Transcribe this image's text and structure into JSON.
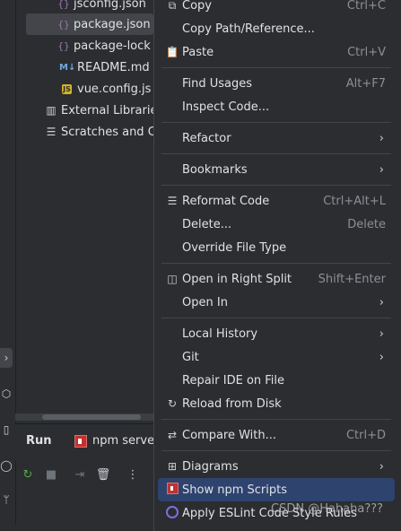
{
  "tree": {
    "items": [
      {
        "label": "jsconfig.json",
        "icon": "json-file-icon"
      },
      {
        "label": "package.json",
        "icon": "json-file-icon"
      },
      {
        "label": "package-lock",
        "icon": "json-file-icon"
      },
      {
        "label": "README.md",
        "icon": "markdown-file-icon"
      },
      {
        "label": "vue.config.js",
        "icon": "js-file-icon"
      },
      {
        "label": "External Librarie",
        "icon": "library-icon"
      },
      {
        "label": "Scratches and C",
        "icon": "scratches-icon"
      }
    ]
  },
  "run_panel": {
    "title": "Run",
    "tab_label": "npm serve"
  },
  "context_menu": {
    "items": [
      {
        "label": "Copy",
        "shortcut": "Ctrl+C"
      },
      {
        "label": "Copy Path/Reference..."
      },
      {
        "label": "Paste",
        "shortcut": "Ctrl+V"
      },
      {
        "label": "Find Usages",
        "shortcut": "Alt+F7"
      },
      {
        "label": "Inspect Code..."
      },
      {
        "label": "Refactor"
      },
      {
        "label": "Bookmarks"
      },
      {
        "label": "Reformat Code",
        "shortcut": "Ctrl+Alt+L"
      },
      {
        "label": "Delete...",
        "shortcut": "Delete"
      },
      {
        "label": "Override File Type"
      },
      {
        "label": "Open in Right Split",
        "shortcut": "Shift+Enter"
      },
      {
        "label": "Open In"
      },
      {
        "label": "Local History"
      },
      {
        "label": "Git"
      },
      {
        "label": "Repair IDE on File"
      },
      {
        "label": "Reload from Disk"
      },
      {
        "label": "Compare With...",
        "shortcut": "Ctrl+D"
      },
      {
        "label": "Diagrams"
      },
      {
        "label": "Show npm Scripts"
      },
      {
        "label": "Apply ESLint Code Style Rules"
      }
    ]
  },
  "watermark": "CSDN @Hahaha???",
  "colors": {
    "background": "#2b2d30",
    "highlight": "#2e436e",
    "selected": "#43454a",
    "npm_red": "#c0332f"
  }
}
